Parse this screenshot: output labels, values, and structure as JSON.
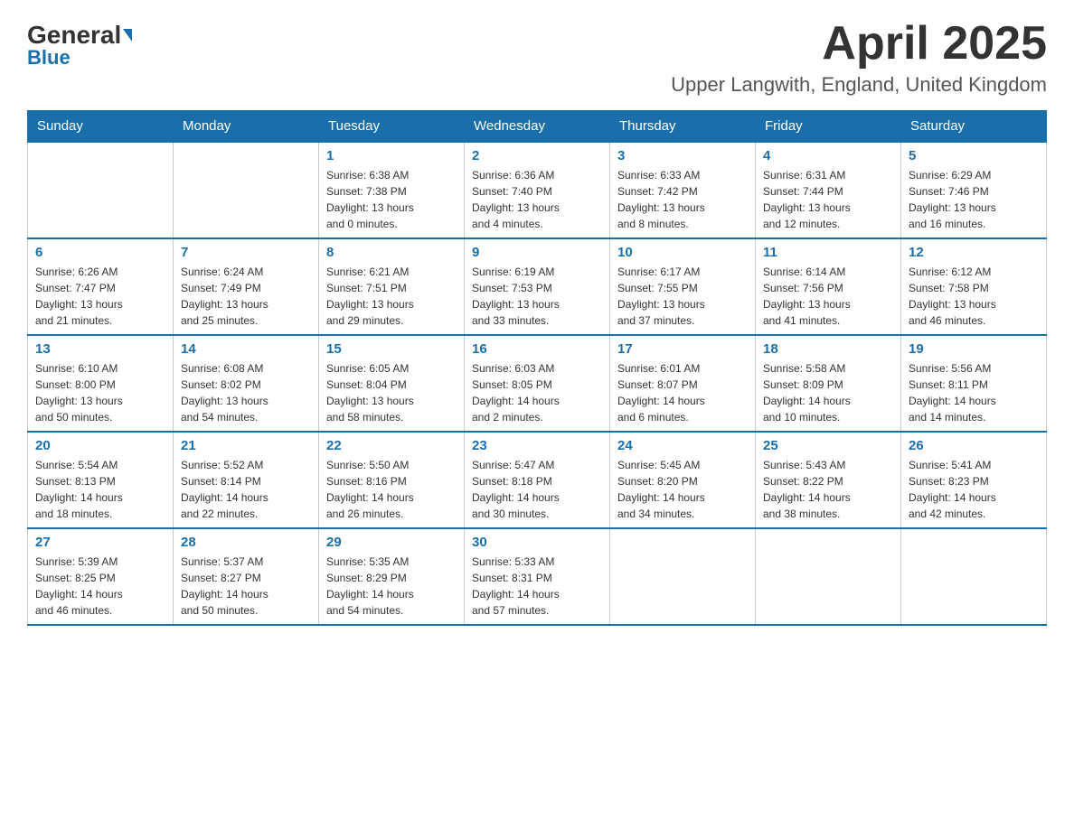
{
  "header": {
    "logo_general": "General",
    "logo_blue": "Blue",
    "month_title": "April 2025",
    "location": "Upper Langwith, England, United Kingdom"
  },
  "calendar": {
    "days_of_week": [
      "Sunday",
      "Monday",
      "Tuesday",
      "Wednesday",
      "Thursday",
      "Friday",
      "Saturday"
    ],
    "weeks": [
      [
        {
          "day": "",
          "info": ""
        },
        {
          "day": "",
          "info": ""
        },
        {
          "day": "1",
          "info": "Sunrise: 6:38 AM\nSunset: 7:38 PM\nDaylight: 13 hours\nand 0 minutes."
        },
        {
          "day": "2",
          "info": "Sunrise: 6:36 AM\nSunset: 7:40 PM\nDaylight: 13 hours\nand 4 minutes."
        },
        {
          "day": "3",
          "info": "Sunrise: 6:33 AM\nSunset: 7:42 PM\nDaylight: 13 hours\nand 8 minutes."
        },
        {
          "day": "4",
          "info": "Sunrise: 6:31 AM\nSunset: 7:44 PM\nDaylight: 13 hours\nand 12 minutes."
        },
        {
          "day": "5",
          "info": "Sunrise: 6:29 AM\nSunset: 7:46 PM\nDaylight: 13 hours\nand 16 minutes."
        }
      ],
      [
        {
          "day": "6",
          "info": "Sunrise: 6:26 AM\nSunset: 7:47 PM\nDaylight: 13 hours\nand 21 minutes."
        },
        {
          "day": "7",
          "info": "Sunrise: 6:24 AM\nSunset: 7:49 PM\nDaylight: 13 hours\nand 25 minutes."
        },
        {
          "day": "8",
          "info": "Sunrise: 6:21 AM\nSunset: 7:51 PM\nDaylight: 13 hours\nand 29 minutes."
        },
        {
          "day": "9",
          "info": "Sunrise: 6:19 AM\nSunset: 7:53 PM\nDaylight: 13 hours\nand 33 minutes."
        },
        {
          "day": "10",
          "info": "Sunrise: 6:17 AM\nSunset: 7:55 PM\nDaylight: 13 hours\nand 37 minutes."
        },
        {
          "day": "11",
          "info": "Sunrise: 6:14 AM\nSunset: 7:56 PM\nDaylight: 13 hours\nand 41 minutes."
        },
        {
          "day": "12",
          "info": "Sunrise: 6:12 AM\nSunset: 7:58 PM\nDaylight: 13 hours\nand 46 minutes."
        }
      ],
      [
        {
          "day": "13",
          "info": "Sunrise: 6:10 AM\nSunset: 8:00 PM\nDaylight: 13 hours\nand 50 minutes."
        },
        {
          "day": "14",
          "info": "Sunrise: 6:08 AM\nSunset: 8:02 PM\nDaylight: 13 hours\nand 54 minutes."
        },
        {
          "day": "15",
          "info": "Sunrise: 6:05 AM\nSunset: 8:04 PM\nDaylight: 13 hours\nand 58 minutes."
        },
        {
          "day": "16",
          "info": "Sunrise: 6:03 AM\nSunset: 8:05 PM\nDaylight: 14 hours\nand 2 minutes."
        },
        {
          "day": "17",
          "info": "Sunrise: 6:01 AM\nSunset: 8:07 PM\nDaylight: 14 hours\nand 6 minutes."
        },
        {
          "day": "18",
          "info": "Sunrise: 5:58 AM\nSunset: 8:09 PM\nDaylight: 14 hours\nand 10 minutes."
        },
        {
          "day": "19",
          "info": "Sunrise: 5:56 AM\nSunset: 8:11 PM\nDaylight: 14 hours\nand 14 minutes."
        }
      ],
      [
        {
          "day": "20",
          "info": "Sunrise: 5:54 AM\nSunset: 8:13 PM\nDaylight: 14 hours\nand 18 minutes."
        },
        {
          "day": "21",
          "info": "Sunrise: 5:52 AM\nSunset: 8:14 PM\nDaylight: 14 hours\nand 22 minutes."
        },
        {
          "day": "22",
          "info": "Sunrise: 5:50 AM\nSunset: 8:16 PM\nDaylight: 14 hours\nand 26 minutes."
        },
        {
          "day": "23",
          "info": "Sunrise: 5:47 AM\nSunset: 8:18 PM\nDaylight: 14 hours\nand 30 minutes."
        },
        {
          "day": "24",
          "info": "Sunrise: 5:45 AM\nSunset: 8:20 PM\nDaylight: 14 hours\nand 34 minutes."
        },
        {
          "day": "25",
          "info": "Sunrise: 5:43 AM\nSunset: 8:22 PM\nDaylight: 14 hours\nand 38 minutes."
        },
        {
          "day": "26",
          "info": "Sunrise: 5:41 AM\nSunset: 8:23 PM\nDaylight: 14 hours\nand 42 minutes."
        }
      ],
      [
        {
          "day": "27",
          "info": "Sunrise: 5:39 AM\nSunset: 8:25 PM\nDaylight: 14 hours\nand 46 minutes."
        },
        {
          "day": "28",
          "info": "Sunrise: 5:37 AM\nSunset: 8:27 PM\nDaylight: 14 hours\nand 50 minutes."
        },
        {
          "day": "29",
          "info": "Sunrise: 5:35 AM\nSunset: 8:29 PM\nDaylight: 14 hours\nand 54 minutes."
        },
        {
          "day": "30",
          "info": "Sunrise: 5:33 AM\nSunset: 8:31 PM\nDaylight: 14 hours\nand 57 minutes."
        },
        {
          "day": "",
          "info": ""
        },
        {
          "day": "",
          "info": ""
        },
        {
          "day": "",
          "info": ""
        }
      ]
    ]
  }
}
